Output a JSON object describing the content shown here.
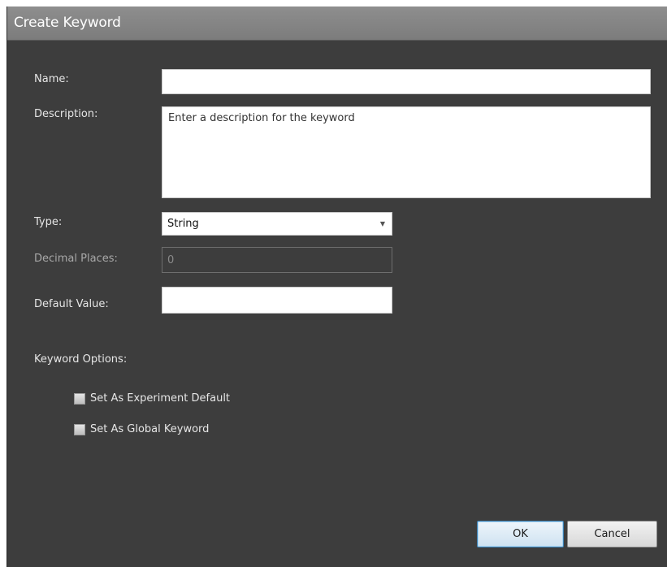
{
  "dialog": {
    "title": "Create Keyword"
  },
  "form": {
    "name_label": "Name:",
    "name_value": "",
    "description_label": "Description:",
    "description_placeholder": "Enter a description for the keyword",
    "type_label": "Type:",
    "type_value": "String",
    "decimal_label": "Decimal Places:",
    "decimal_value": "0",
    "default_label": "Default Value:",
    "default_value": ""
  },
  "options": {
    "heading": "Keyword Options:",
    "items": [
      {
        "label": "Set As Experiment Default",
        "checked": false
      },
      {
        "label": "Set As Global Keyword",
        "checked": false
      }
    ]
  },
  "buttons": {
    "ok_label": "OK",
    "cancel_label": "Cancel"
  },
  "icons": {
    "dropdown": "chevron-down-icon"
  }
}
